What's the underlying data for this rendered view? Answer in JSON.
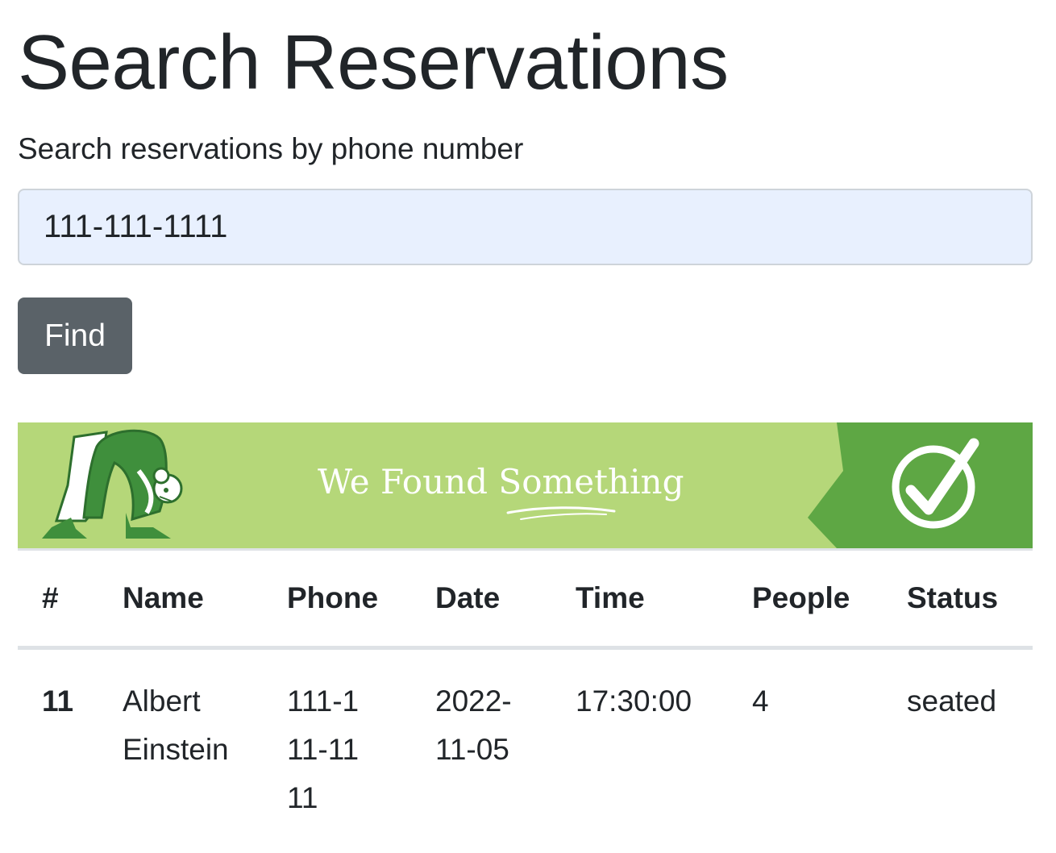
{
  "header": {
    "title": "Search Reservations"
  },
  "search": {
    "label": "Search reservations by phone number",
    "value": "111-111-1111",
    "find_label": "Find"
  },
  "banner": {
    "text": "We Found Something",
    "colors": {
      "background": "#b5d779",
      "accent": "#5ea744",
      "figure": "#3f8f3c"
    },
    "icons": [
      "person-illustration",
      "check-circle-icon"
    ]
  },
  "table": {
    "headers": [
      "#",
      "Name",
      "Phone",
      "Date",
      "Time",
      "People",
      "Status"
    ],
    "rows": [
      {
        "id": "11",
        "name": "Albert Einstein",
        "phone": "111-111-1111",
        "date": "2022-11-05",
        "time": "17:30:00",
        "people": "4",
        "status": "seated"
      }
    ]
  }
}
